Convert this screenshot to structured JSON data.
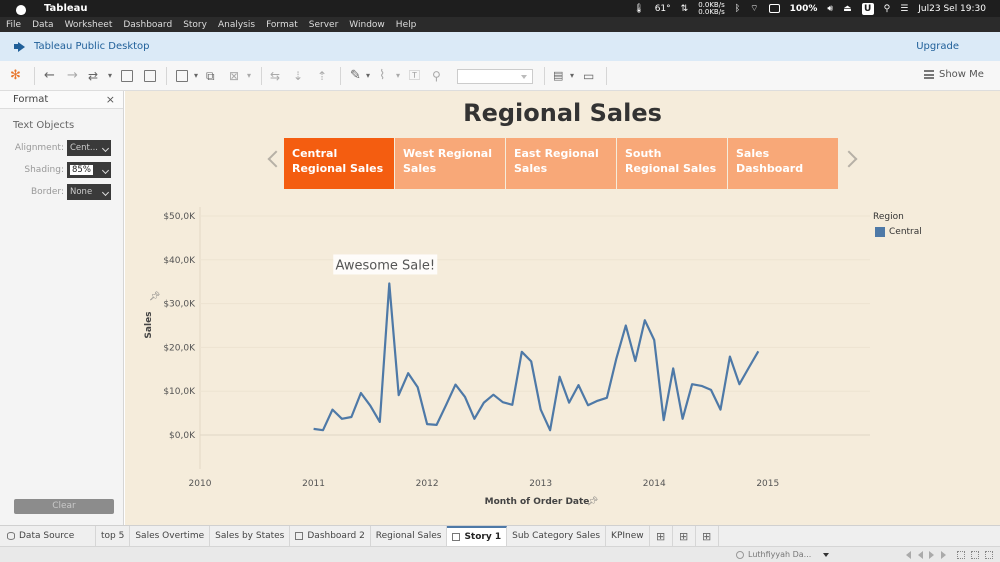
{
  "mac": {
    "app": "Tableau",
    "temp": "61°",
    "net_up": "0.0KB/s",
    "net_down": "0.0KB/s",
    "battery": "100%",
    "user_badge": "U",
    "datetime": "Jul23 Sel 19:30"
  },
  "menu": [
    "File",
    "Data",
    "Worksheet",
    "Dashboard",
    "Story",
    "Analysis",
    "Format",
    "Server",
    "Window",
    "Help"
  ],
  "banner": {
    "title": "Tableau Public Desktop",
    "upgrade": "Upgrade"
  },
  "toolbar": {
    "show_me": "Show Me"
  },
  "format_pane": {
    "title": "Format",
    "close": "×",
    "section": "Text Objects",
    "alignment_label": "Alignment:",
    "alignment_value": "Cent...",
    "shading_label": "Shading:",
    "shading_value": "85%",
    "border_label": "Border:",
    "border_value": "None",
    "clear": "Clear"
  },
  "story": {
    "title": "Regional Sales",
    "points": [
      {
        "label": "Central Regional Sales",
        "active": true
      },
      {
        "label": "West Regional Sales",
        "active": false
      },
      {
        "label": "East Regional Sales",
        "active": false
      },
      {
        "label": "South Regional Sales",
        "active": false
      },
      {
        "label": "Sales Dashboard",
        "active": false
      }
    ]
  },
  "chart_data": {
    "type": "line",
    "xlabel": "Month of Order Date",
    "ylabel": "Sales",
    "x_ticks": [
      "2010",
      "2011",
      "2012",
      "2013",
      "2014",
      "2015"
    ],
    "y_ticks": [
      "$0,0K",
      "$10,0K",
      "$20,0K",
      "$30,0K",
      "$40,0K",
      "$50,0K"
    ],
    "ylim": [
      0,
      50000
    ],
    "annotation": "Awesome Sale!",
    "legend_title": "Region",
    "series": [
      {
        "name": "Central",
        "color": "#4e79a7",
        "x": [
          "2011-01",
          "2011-02",
          "2011-03",
          "2011-04",
          "2011-05",
          "2011-06",
          "2011-07",
          "2011-08",
          "2011-09",
          "2011-10",
          "2011-11",
          "2011-12",
          "2012-01",
          "2012-02",
          "2012-03",
          "2012-04",
          "2012-05",
          "2012-06",
          "2012-07",
          "2012-08",
          "2012-09",
          "2012-10",
          "2012-11",
          "2012-12",
          "2013-01",
          "2013-02",
          "2013-03",
          "2013-04",
          "2013-05",
          "2013-06",
          "2013-07",
          "2013-08",
          "2013-09",
          "2013-10",
          "2013-11",
          "2013-12",
          "2014-01",
          "2014-02",
          "2014-03",
          "2014-04",
          "2014-05",
          "2014-06",
          "2014-07",
          "2014-08",
          "2014-09",
          "2014-10",
          "2014-11",
          "2014-12"
        ],
        "values": [
          1400,
          1100,
          5800,
          3700,
          4100,
          9600,
          6700,
          3000,
          34600,
          9100,
          14100,
          10900,
          2500,
          2300,
          6800,
          11500,
          8700,
          3700,
          7400,
          9200,
          7500,
          6900,
          19000,
          16800,
          5800,
          1100,
          13300,
          7400,
          11400,
          6800,
          7800,
          8500,
          17500,
          25000,
          16900,
          26200,
          21700,
          3400,
          15200,
          3700,
          11600,
          11200,
          10300,
          5800,
          17900,
          11600,
          15400,
          19100
        ]
      }
    ]
  },
  "tabs": [
    {
      "label": "Data Source",
      "icon": "database-icon"
    },
    {
      "label": "top 5"
    },
    {
      "label": "Sales Overtime"
    },
    {
      "label": "Sales by States"
    },
    {
      "label": "Dashboard 2",
      "icon": "dashboard-icon"
    },
    {
      "label": "Regional Sales"
    },
    {
      "label": "Story 1",
      "icon": "story-icon",
      "active": true
    },
    {
      "label": "Sub Category Sales"
    },
    {
      "label": "KPInew"
    }
  ],
  "status": {
    "user": "Luthfiyyah Da..."
  }
}
